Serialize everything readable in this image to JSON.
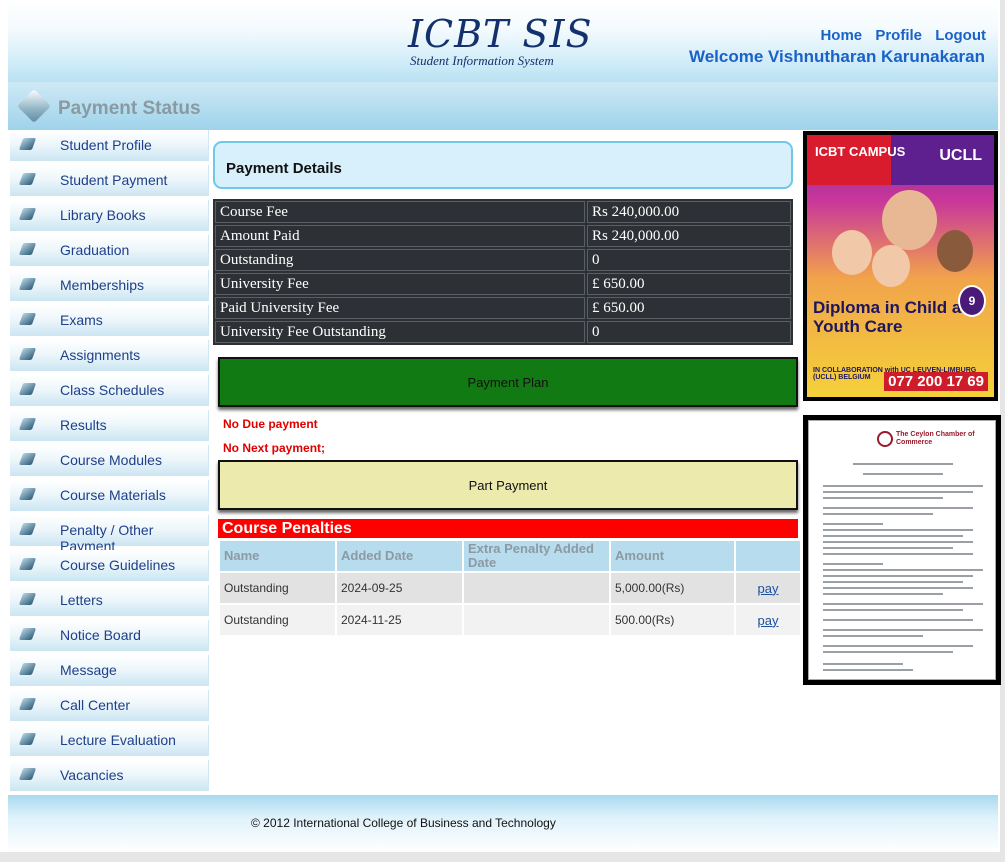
{
  "header": {
    "logo_title": "ICBT SIS",
    "logo_subtitle": "Student Information System",
    "links": [
      "Home",
      "Profile",
      "Logout"
    ],
    "welcome": "Welcome Vishnutharan Karunakaran"
  },
  "page_title": "Payment Status",
  "sidebar": {
    "items": [
      {
        "label": "Student Profile"
      },
      {
        "label": "Student Payment"
      },
      {
        "label": "Library Books"
      },
      {
        "label": "Graduation"
      },
      {
        "label": "Memberships"
      },
      {
        "label": "Exams"
      },
      {
        "label": "Assignments"
      },
      {
        "label": "Class Schedules"
      },
      {
        "label": "Results"
      },
      {
        "label": "Course Modules"
      },
      {
        "label": "Course Materials"
      },
      {
        "label": "Penalty / Other Payment"
      },
      {
        "label": "Course Guidelines"
      },
      {
        "label": "Letters"
      },
      {
        "label": "Notice Board"
      },
      {
        "label": "Message"
      },
      {
        "label": "Call Center"
      },
      {
        "label": "Lecture Evaluation"
      },
      {
        "label": "Vacancies"
      }
    ]
  },
  "payment_details": {
    "title": "Payment Details",
    "rows": [
      {
        "label": "Course Fee",
        "value": "Rs 240,000.00"
      },
      {
        "label": "Amount Paid",
        "value": "Rs 240,000.00"
      },
      {
        "label": "Outstanding",
        "value": "0"
      },
      {
        "label": "University Fee",
        "value": "£ 650.00"
      },
      {
        "label": "Paid University Fee",
        "value": "£ 650.00"
      },
      {
        "label": "University Fee Outstanding",
        "value": "0"
      }
    ]
  },
  "buttons": {
    "payment_plan": "Payment Plan",
    "part_payment": "Part Payment"
  },
  "messages": {
    "no_due": "No Due payment",
    "no_next": "No Next payment;"
  },
  "penalties": {
    "title": "Course Penalties",
    "columns": [
      "Name",
      "Added Date",
      "Extra Penalty Added Date",
      "Amount",
      ""
    ],
    "rows": [
      {
        "name": "Outstanding",
        "added_date": "2024-09-25",
        "extra_penalty_date": "",
        "amount": "5,000.00(Rs)",
        "action": "pay"
      },
      {
        "name": "Outstanding",
        "added_date": "2024-11-25",
        "extra_penalty_date": "",
        "amount": "500.00(Rs)",
        "action": "pay"
      }
    ]
  },
  "ads": {
    "ad1": {
      "brand_left": "ICBT CAMPUS",
      "brand_right": "UCLL",
      "headline": "Diploma in Child and Youth Care",
      "badge": "9",
      "collab": "IN COLLABORATION with UC LEUVEN-LIMBURG (UCLL) BELGIUM",
      "phone": "077 200 17 69"
    },
    "ad2": {
      "org": "The Ceylon Chamber of Commerce"
    }
  },
  "footer": {
    "text": "© 2012 International College of Business and Technology"
  },
  "colors": {
    "accent_blue": "#1a62c8",
    "plan_green": "#127a12",
    "part_yellow": "#ecebad",
    "penalty_red": "#ff0000",
    "fees_bg": "#2d3136"
  }
}
